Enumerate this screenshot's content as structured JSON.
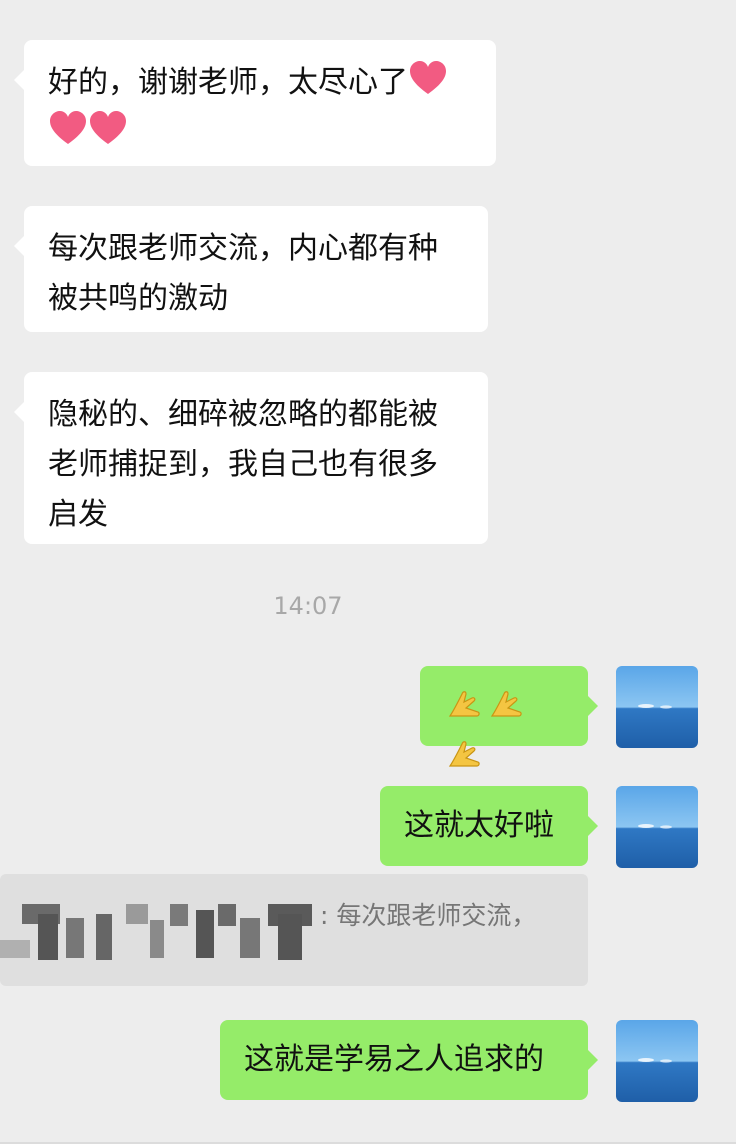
{
  "messages": [
    {
      "side": "left",
      "text": "好的，谢谢老师，太尽心了"
    },
    {
      "side": "left",
      "text": "每次跟老师交流，内心都有种被共鸣的激动"
    },
    {
      "side": "left",
      "text": "隐秘的、细碎被忽略的都能被老师捕捉到，我自己也有很多启发"
    }
  ],
  "timestamp": "14:07",
  "replies": [
    {
      "side": "right",
      "emoji": "pray-icon",
      "count": 3
    },
    {
      "side": "right",
      "text": "这就太好啦"
    },
    {
      "side": "right",
      "text": "这就是学易之人追求的"
    }
  ],
  "quote": {
    "text": ": 每次跟老师交流，"
  },
  "colors": {
    "background": "#ededed",
    "incoming_bubble": "#ffffff",
    "outgoing_bubble": "#95ec69",
    "timestamp": "#a8a8a8",
    "quote_bg": "#dfdfdf"
  }
}
